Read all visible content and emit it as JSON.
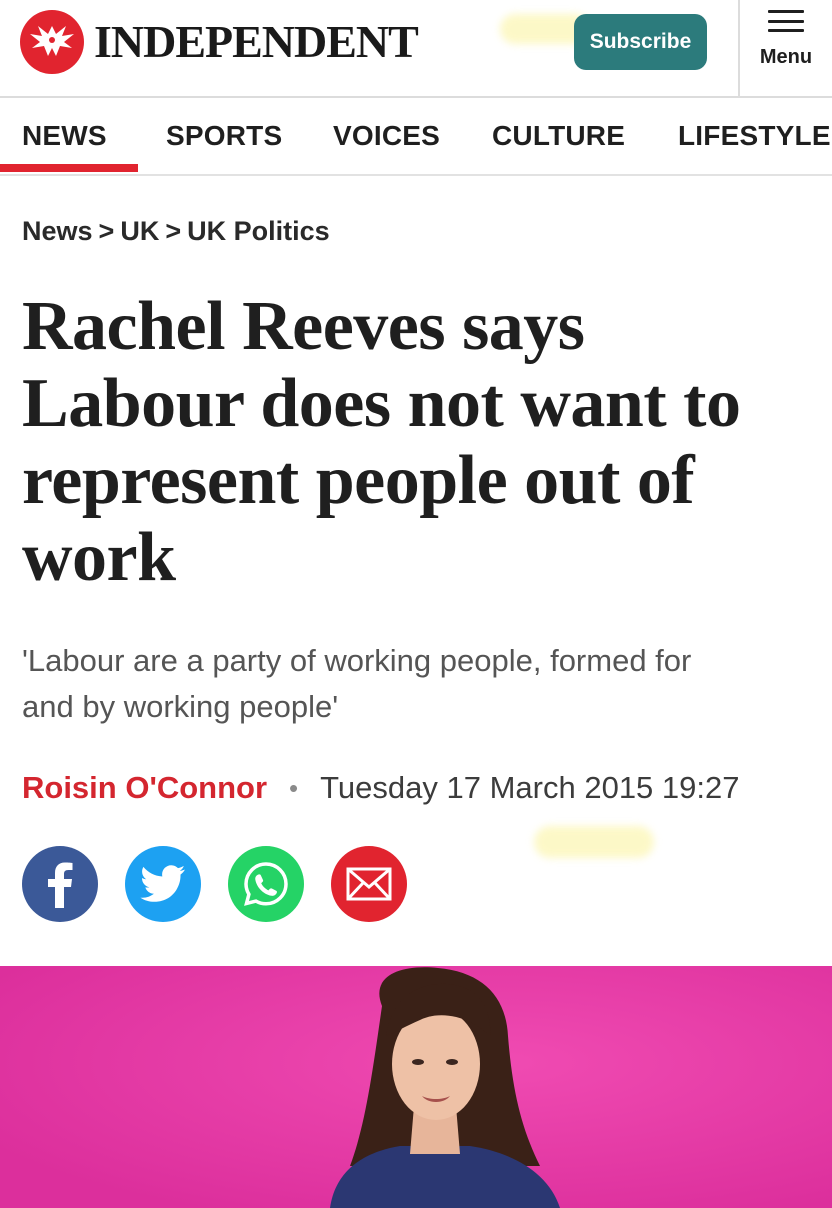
{
  "header": {
    "logo_text": "INDEPENDENT",
    "subscribe_label": "Subscribe",
    "menu_label": "Menu"
  },
  "nav": {
    "items": [
      {
        "label": "NEWS",
        "active": true
      },
      {
        "label": "SPORTS"
      },
      {
        "label": "VOICES"
      },
      {
        "label": "CULTURE"
      },
      {
        "label": "LIFESTYLE"
      }
    ]
  },
  "breadcrumb": {
    "items": [
      "News",
      "UK",
      "UK Politics"
    ],
    "separator": ">"
  },
  "article": {
    "headline_lines": [
      "Rachel Reeves says",
      "Labour does not want to",
      "represent people out of",
      "work"
    ],
    "standfirst_lines": [
      "'Labour are a party of working people, formed for",
      "and by working people'"
    ],
    "author": "Roisin O'Connor",
    "bullet": "•",
    "date": "Tuesday 17 March 2015 19:27"
  },
  "share": {
    "icons": [
      "facebook-icon",
      "twitter-icon",
      "whatsapp-icon",
      "email-icon"
    ]
  },
  "colors": {
    "brand_red": "#e1242f",
    "subscribe_teal": "#2c7b7c",
    "author_red": "#d4262f",
    "facebook": "#3b5998",
    "twitter": "#1da1f2",
    "whatsapp": "#25d366",
    "hero_background": "#e83ca6"
  }
}
